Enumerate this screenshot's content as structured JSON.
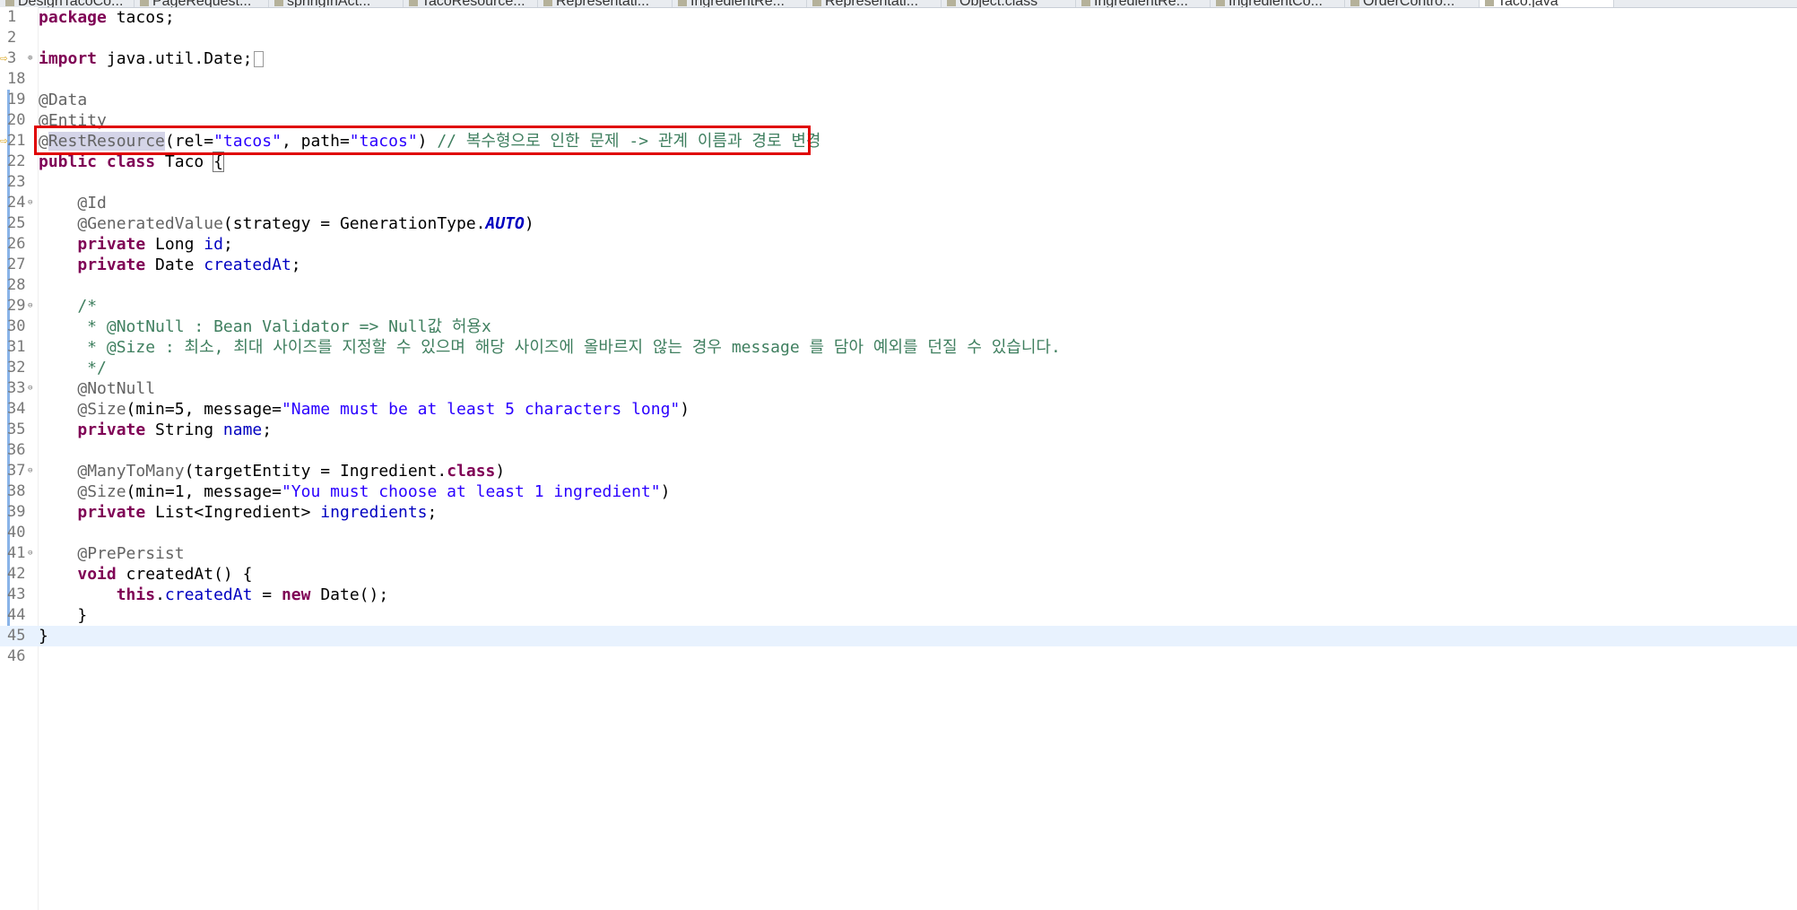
{
  "tabs": [
    {
      "label": "DesignTacoCo..."
    },
    {
      "label": "PageRequest..."
    },
    {
      "label": "springInAct..."
    },
    {
      "label": "TacoResource..."
    },
    {
      "label": "Representati..."
    },
    {
      "label": "IngredientRe..."
    },
    {
      "label": "Representati..."
    },
    {
      "label": "Object.class"
    },
    {
      "label": "IngredientRe..."
    },
    {
      "label": "IngredientCo..."
    },
    {
      "label": "OrderContro..."
    },
    {
      "label": "Taco.java"
    }
  ],
  "editor": {
    "file": "Taco.java",
    "lines": [
      {
        "n": "1",
        "code": [
          {
            "t": "package",
            "c": "kw"
          },
          {
            "t": " tacos;"
          }
        ]
      },
      {
        "n": "2",
        "code": []
      },
      {
        "n": "3",
        "fold": "+",
        "warn": true,
        "code": [
          {
            "t": "import",
            "c": "kw"
          },
          {
            "t": " java.util.Date;"
          }
        ]
      },
      {
        "n": "18",
        "code": []
      },
      {
        "n": "19",
        "code": [
          {
            "t": "@Data",
            "c": "ann"
          }
        ]
      },
      {
        "n": "20",
        "code": [
          {
            "t": "@Entity",
            "c": "ann"
          }
        ]
      },
      {
        "n": "21",
        "warn": true,
        "code": [
          {
            "t": "@",
            "c": "ann"
          },
          {
            "t": "RestResource",
            "c": "ann hl"
          },
          {
            "t": "(rel="
          },
          {
            "t": "\"tacos\"",
            "c": "str"
          },
          {
            "t": ", path="
          },
          {
            "t": "\"tacos\"",
            "c": "str"
          },
          {
            "t": ") "
          },
          {
            "t": "// 복수형으로 인한 문제 -> 관계 이름과 경로 변경",
            "c": "cmt"
          }
        ]
      },
      {
        "n": "22",
        "code": [
          {
            "t": "public",
            "c": "kw"
          },
          {
            "t": " "
          },
          {
            "t": "class",
            "c": "kw"
          },
          {
            "t": " Taco "
          },
          {
            "t": "{",
            "c": "bracket"
          }
        ]
      },
      {
        "n": "23",
        "code": []
      },
      {
        "n": "24",
        "fold": "-",
        "code": [
          {
            "t": "    "
          },
          {
            "t": "@Id",
            "c": "ann"
          }
        ]
      },
      {
        "n": "25",
        "code": [
          {
            "t": "    "
          },
          {
            "t": "@GeneratedValue",
            "c": "ann"
          },
          {
            "t": "(strategy = GenerationType."
          },
          {
            "t": "AUTO",
            "c": "stat"
          },
          {
            "t": ")"
          }
        ]
      },
      {
        "n": "26",
        "code": [
          {
            "t": "    "
          },
          {
            "t": "private",
            "c": "kw"
          },
          {
            "t": " Long "
          },
          {
            "t": "id",
            "c": "fld"
          },
          {
            "t": ";"
          }
        ]
      },
      {
        "n": "27",
        "code": [
          {
            "t": "    "
          },
          {
            "t": "private",
            "c": "kw"
          },
          {
            "t": " Date "
          },
          {
            "t": "createdAt",
            "c": "fld"
          },
          {
            "t": ";"
          }
        ]
      },
      {
        "n": "28",
        "code": []
      },
      {
        "n": "29",
        "fold": "-",
        "code": [
          {
            "t": "    "
          },
          {
            "t": "/*",
            "c": "cmt"
          }
        ]
      },
      {
        "n": "30",
        "code": [
          {
            "t": "     * @NotNull : Bean Validator => Null값 허용x",
            "c": "cmt"
          }
        ]
      },
      {
        "n": "31",
        "code": [
          {
            "t": "     * @Size : 최소, 최대 사이즈를 지정할 수 있으며 해당 사이즈에 올바르지 않는 경우 message 를 담아 예외를 던질 수 있습니다.",
            "c": "cmt"
          }
        ]
      },
      {
        "n": "32",
        "code": [
          {
            "t": "     */",
            "c": "cmt"
          }
        ]
      },
      {
        "n": "33",
        "fold": "-",
        "code": [
          {
            "t": "    "
          },
          {
            "t": "@NotNull",
            "c": "ann"
          }
        ]
      },
      {
        "n": "34",
        "code": [
          {
            "t": "    "
          },
          {
            "t": "@Size",
            "c": "ann"
          },
          {
            "t": "(min=5, message="
          },
          {
            "t": "\"Name must be at least 5 characters long\"",
            "c": "str"
          },
          {
            "t": ")"
          }
        ]
      },
      {
        "n": "35",
        "code": [
          {
            "t": "    "
          },
          {
            "t": "private",
            "c": "kw"
          },
          {
            "t": " String "
          },
          {
            "t": "name",
            "c": "fld"
          },
          {
            "t": ";"
          }
        ]
      },
      {
        "n": "36",
        "code": []
      },
      {
        "n": "37",
        "fold": "-",
        "code": [
          {
            "t": "    "
          },
          {
            "t": "@ManyToMany",
            "c": "ann"
          },
          {
            "t": "(targetEntity = Ingredient."
          },
          {
            "t": "class",
            "c": "kw"
          },
          {
            "t": ")"
          }
        ]
      },
      {
        "n": "38",
        "code": [
          {
            "t": "    "
          },
          {
            "t": "@Size",
            "c": "ann"
          },
          {
            "t": "(min=1, message="
          },
          {
            "t": "\"You must choose at least 1 ingredient\"",
            "c": "str"
          },
          {
            "t": ")"
          }
        ]
      },
      {
        "n": "39",
        "code": [
          {
            "t": "    "
          },
          {
            "t": "private",
            "c": "kw"
          },
          {
            "t": " List<Ingredient> "
          },
          {
            "t": "ingredients",
            "c": "fld"
          },
          {
            "t": ";"
          }
        ]
      },
      {
        "n": "40",
        "code": []
      },
      {
        "n": "41",
        "fold": "-",
        "code": [
          {
            "t": "    "
          },
          {
            "t": "@PrePersist",
            "c": "ann"
          }
        ]
      },
      {
        "n": "42",
        "code": [
          {
            "t": "    "
          },
          {
            "t": "void",
            "c": "kw"
          },
          {
            "t": " createdAt() {"
          }
        ]
      },
      {
        "n": "43",
        "code": [
          {
            "t": "        "
          },
          {
            "t": "this",
            "c": "kw"
          },
          {
            "t": "."
          },
          {
            "t": "createdAt",
            "c": "fld"
          },
          {
            "t": " = "
          },
          {
            "t": "new",
            "c": "kw"
          },
          {
            "t": " Date();"
          }
        ]
      },
      {
        "n": "44",
        "code": [
          {
            "t": "    }"
          }
        ]
      },
      {
        "n": "45",
        "current": true,
        "code": [
          {
            "t": "}"
          }
        ]
      },
      {
        "n": "46",
        "code": []
      }
    ]
  }
}
